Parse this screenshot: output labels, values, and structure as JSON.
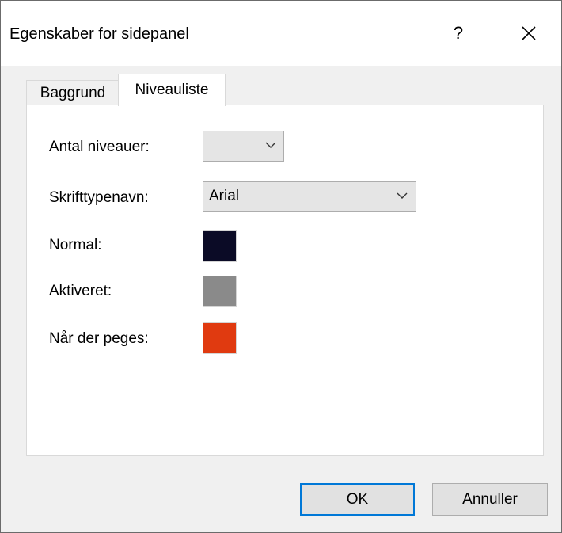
{
  "window": {
    "title": "Egenskaber for sidepanel",
    "help_label": "?"
  },
  "tabs": [
    {
      "label": "Baggrund",
      "active": false
    },
    {
      "label": "Niveauliste",
      "active": true
    }
  ],
  "form": {
    "levels_label": "Antal niveauer:",
    "levels_value": "",
    "font_label": "Skrifttypenavn:",
    "font_value": "Arial",
    "normal_label": "Normal:",
    "normal_color": "#0b0b26",
    "activated_label": "Aktiveret:",
    "activated_color": "#8a8a8a",
    "hover_label": "Når der peges:",
    "hover_color": "#e03a10"
  },
  "buttons": {
    "ok_label": "OK",
    "cancel_label": "Annuller"
  },
  "icons": {
    "close": "close-icon",
    "dropdown": "chevron-down-icon"
  }
}
